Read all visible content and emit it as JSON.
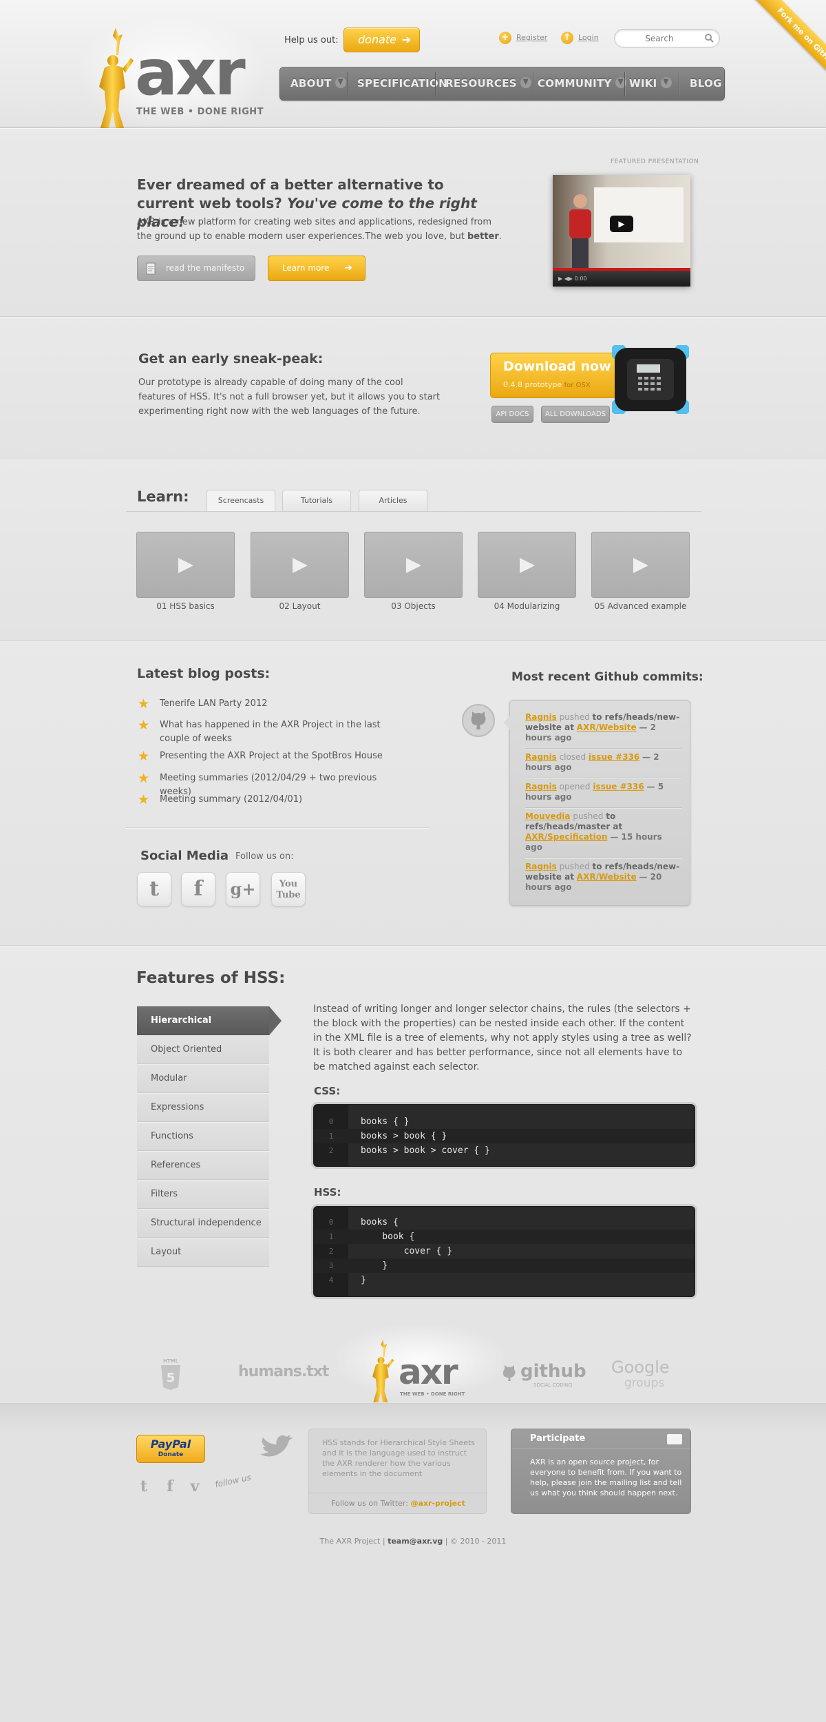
{
  "header": {
    "logo_text": "axr",
    "tagline": "THE WEB  •  DONE RIGHT",
    "help_label": "Help us out:",
    "donate_label": "donate",
    "register_label": "Register",
    "login_label": "Login",
    "search_placeholder": "Search",
    "nav": [
      "ABOUT",
      "SPECIFICATION",
      "RESOURCES",
      "COMMUNITY",
      "WIKI",
      "BLOG"
    ],
    "ribbon": "Fork me on GitHub"
  },
  "hero": {
    "title_plain": "Ever dreamed of a better alternative to current web tools?",
    "title_em": "You've come to the right place!",
    "text_main": "AXR is a new platform for creating web sites and applications, redesigned from the ground up to enable modern user experiences.The web you love, but",
    "text_strong": "better",
    "text_end": ".",
    "manifesto_label": "read the manifesto",
    "learn_more_label": "Learn more",
    "featured_label": "FEATURED PRESENTATION",
    "video_time": "0:00"
  },
  "sneak": {
    "title": "Get an early sneak-peak:",
    "text": "Our prototype is already capable of doing many of the cool features of HSS. It's not a full browser yet, but it allows you to start experimenting right now with the web languages of the future.",
    "download_label": "Download now",
    "version": "0.4.8 prototype",
    "platform": "for OSX",
    "api_docs": "API DOCS",
    "all_downloads": "ALL DOWNLOADS"
  },
  "learn": {
    "title": "Learn:",
    "tabs": [
      "Screencasts",
      "Tutorials",
      "Articles"
    ],
    "videos": [
      "01 HSS basics",
      "02 Layout",
      "03 Objects",
      "04 Modularizing",
      "05 Advanced example"
    ]
  },
  "blog": {
    "title": "Latest blog posts:",
    "posts": [
      "Tenerife LAN Party 2012",
      "What has happened in the AXR Project in the last couple of weeks",
      "Presenting the AXR Project at the SpotBros House",
      "Meeting summaries (2012/04/29 + two previous weeks)",
      "Meeting summary (2012/04/01)"
    ]
  },
  "social": {
    "title": "Social Media",
    "follow": "Follow us on:"
  },
  "commits": {
    "title": "Most recent Github commits:",
    "items": [
      {
        "user": "Ragnis",
        "verb": "pushed",
        "detail": "to refs/heads/new-website at",
        "target": "AXR/Website",
        "time": "— 2 hours ago"
      },
      {
        "user": "Ragnis",
        "verb": "closed",
        "detail": "",
        "target": "issue #336",
        "time": "— 2 hours ago"
      },
      {
        "user": "Ragnis",
        "verb": "opened",
        "detail": "",
        "target": "issue #336",
        "time": "— 5 hours ago"
      },
      {
        "user": "Mouvedia",
        "verb": "pushed",
        "detail": "to refs/heads/master at",
        "target": "AXR/Specification",
        "time": "— 15 hours ago"
      },
      {
        "user": "Ragnis",
        "verb": "pushed",
        "detail": "to refs/heads/new-website at",
        "target": "AXR/Website",
        "time": "— 20 hours ago"
      }
    ]
  },
  "features": {
    "title": "Features of HSS:",
    "items": [
      "Hierarchical",
      "Object Oriented",
      "Modular",
      "Expressions",
      "Functions",
      "References",
      "Filters",
      "Structural independence",
      "Layout"
    ],
    "active": "Hierarchical",
    "description": "Instead of writing longer and longer selector chains, the rules (the selectors + the block with the properties) can be nested inside each other. If the content in the XML file is a tree of elements, why not apply styles using a tree as well? It is both clearer and has better performance, since not all elements have to be matched against each selector.",
    "css_label": "CSS:",
    "css_lines": [
      "books { }",
      "books > book { }",
      "books > book > cover { }"
    ],
    "hss_label": "HSS:",
    "hss_lines": [
      "books {",
      "    book {",
      "        cover { }",
      "    }",
      "}"
    ]
  },
  "partners": {
    "html5": "HTML",
    "humans": "humans.txt",
    "github": "github",
    "github_sub": "SOCIAL CODING",
    "google": "Google",
    "groups": "groups"
  },
  "footer": {
    "paypal": "PayPal",
    "paypal_sub": "Donate",
    "follow_us": "follow us",
    "about_text": "HSS stands for Hierarchical Style Sheets and it is the language used to instruct the AXR renderer how the various elements in the document",
    "twitter_label": "Follow us on Twitter:",
    "twitter_handle": "@axr-project",
    "participate_title": "Participate",
    "participate_text": "AXR is an open source project, for everyone to benefit from. If you want to help, please join the mailing list and tell us what you think should happen next.",
    "copyright_pre": "The AXR Project |",
    "email": "team@axr.vg",
    "copyright_post": "| © 2010 - 2011"
  },
  "colors": {
    "accent": "#eaa812",
    "nav_bg": "#7a7a7a",
    "code_bg": "#2a2a2a"
  }
}
